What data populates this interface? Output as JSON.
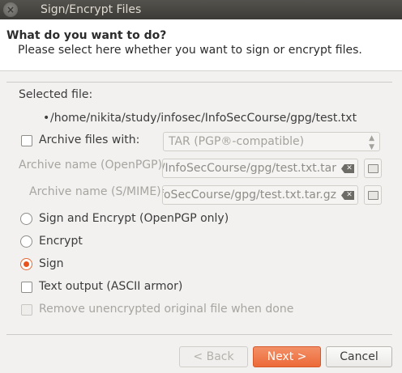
{
  "window": {
    "title": "Sign/Encrypt Files",
    "close_glyph": "×"
  },
  "header": {
    "title": "What do you want to do?",
    "subtitle": "Please select here whether you want to sign or encrypt files."
  },
  "selected_file": {
    "label": "Selected file:",
    "bullet": "•",
    "path": "/home/nikita/study/infosec/InfoSecCourse/gpg/test.txt"
  },
  "archive": {
    "checkbox_label": "Archive files with:",
    "checked": false,
    "format_value": "TAR (PGP®-compatible)",
    "openpgp_label": "Archive name (OpenPGP):",
    "openpgp_value": "c/InfoSecCourse/gpg/test.txt.tar",
    "smime_label": "Archive name (S/MIME):",
    "smime_value": "nfoSecCourse/gpg/test.txt.tar.gz"
  },
  "operations": {
    "sign_encrypt_label": "Sign and Encrypt (OpenPGP only)",
    "encrypt_label": "Encrypt",
    "sign_label": "Sign",
    "selected": "sign"
  },
  "options": {
    "text_output_label": "Text output (ASCII armor)",
    "text_output_checked": false,
    "remove_original_label": "Remove unencrypted original file when done",
    "remove_original_enabled": false
  },
  "buttons": {
    "back_label": "< Back",
    "next_label": "Next >",
    "cancel_label": "Cancel"
  },
  "colors": {
    "accent": "#e9541e",
    "titlebar": "#3d3b37",
    "window_bg": "#f2f1f0"
  },
  "icons": [
    "close-icon",
    "clear-icon",
    "folder-icon",
    "combo-arrow-icon"
  ]
}
